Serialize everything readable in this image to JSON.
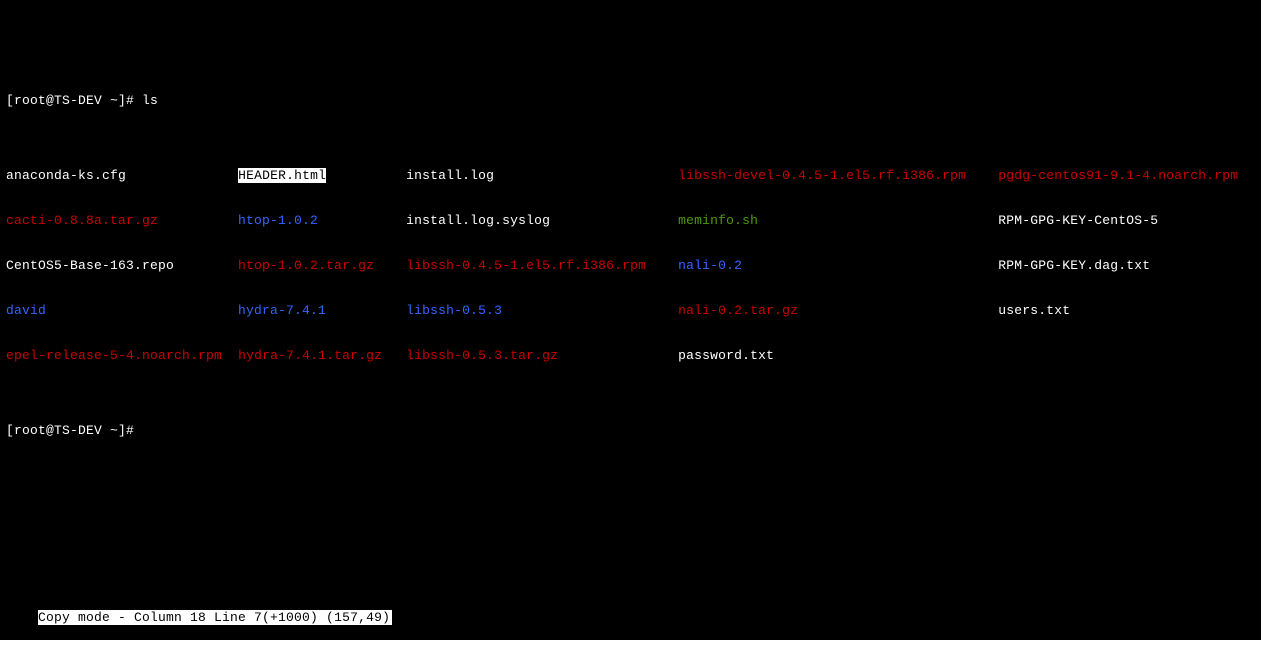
{
  "prompt_user": "root",
  "prompt_host": "TS-DEV",
  "prompt_path": "~",
  "prompt_symbol": "#",
  "command": "ls",
  "listing": [
    {
      "text": "anaconda-ks.cfg",
      "cls": "white",
      "col": 0
    },
    {
      "text": "cacti-0.8.8a.tar.gz",
      "cls": "red",
      "col": 0
    },
    {
      "text": "CentOS5-Base-163.repo",
      "cls": "white",
      "col": 0
    },
    {
      "text": "david",
      "cls": "blue",
      "col": 0
    },
    {
      "text": "epel-release-5-4.noarch.rpm",
      "cls": "red",
      "col": 0
    },
    {
      "text": "HEADER.html",
      "cls": "sel",
      "col": 1
    },
    {
      "text": "htop-1.0.2",
      "cls": "blue",
      "col": 1
    },
    {
      "text": "htop-1.0.2.tar.gz",
      "cls": "red",
      "col": 1
    },
    {
      "text": "hydra-7.4.1",
      "cls": "blue",
      "col": 1
    },
    {
      "text": "hydra-7.4.1.tar.gz",
      "cls": "red",
      "col": 1
    },
    {
      "text": "install.log",
      "cls": "white",
      "col": 2
    },
    {
      "text": "install.log.syslog",
      "cls": "white",
      "col": 2
    },
    {
      "text": "libssh-0.4.5-1.el5.rf.i386.rpm",
      "cls": "red",
      "col": 2
    },
    {
      "text": "libssh-0.5.3",
      "cls": "blue",
      "col": 2
    },
    {
      "text": "libssh-0.5.3.tar.gz",
      "cls": "red",
      "col": 2
    },
    {
      "text": "libssh-devel-0.4.5-1.el5.rf.i386.rpm",
      "cls": "red",
      "col": 3
    },
    {
      "text": "meminfo.sh",
      "cls": "green",
      "col": 3
    },
    {
      "text": "nali-0.2",
      "cls": "blue",
      "col": 3
    },
    {
      "text": "nali-0.2.tar.gz",
      "cls": "red",
      "col": 3
    },
    {
      "text": "password.txt",
      "cls": "white",
      "col": 3
    },
    {
      "text": "pgdg-centos91-9.1-4.noarch.rpm",
      "cls": "red",
      "col": 4
    },
    {
      "text": "RPM-GPG-KEY-CentOS-5",
      "cls": "white",
      "col": 4
    },
    {
      "text": "RPM-GPG-KEY.dag.txt",
      "cls": "white",
      "col": 4
    },
    {
      "text": "users.txt",
      "cls": "white",
      "col": 4
    }
  ],
  "col_pad": [
    29,
    21,
    34,
    40,
    40
  ],
  "status_bar": "Copy mode - Column 18 Line 7(+1000) (157,49)"
}
